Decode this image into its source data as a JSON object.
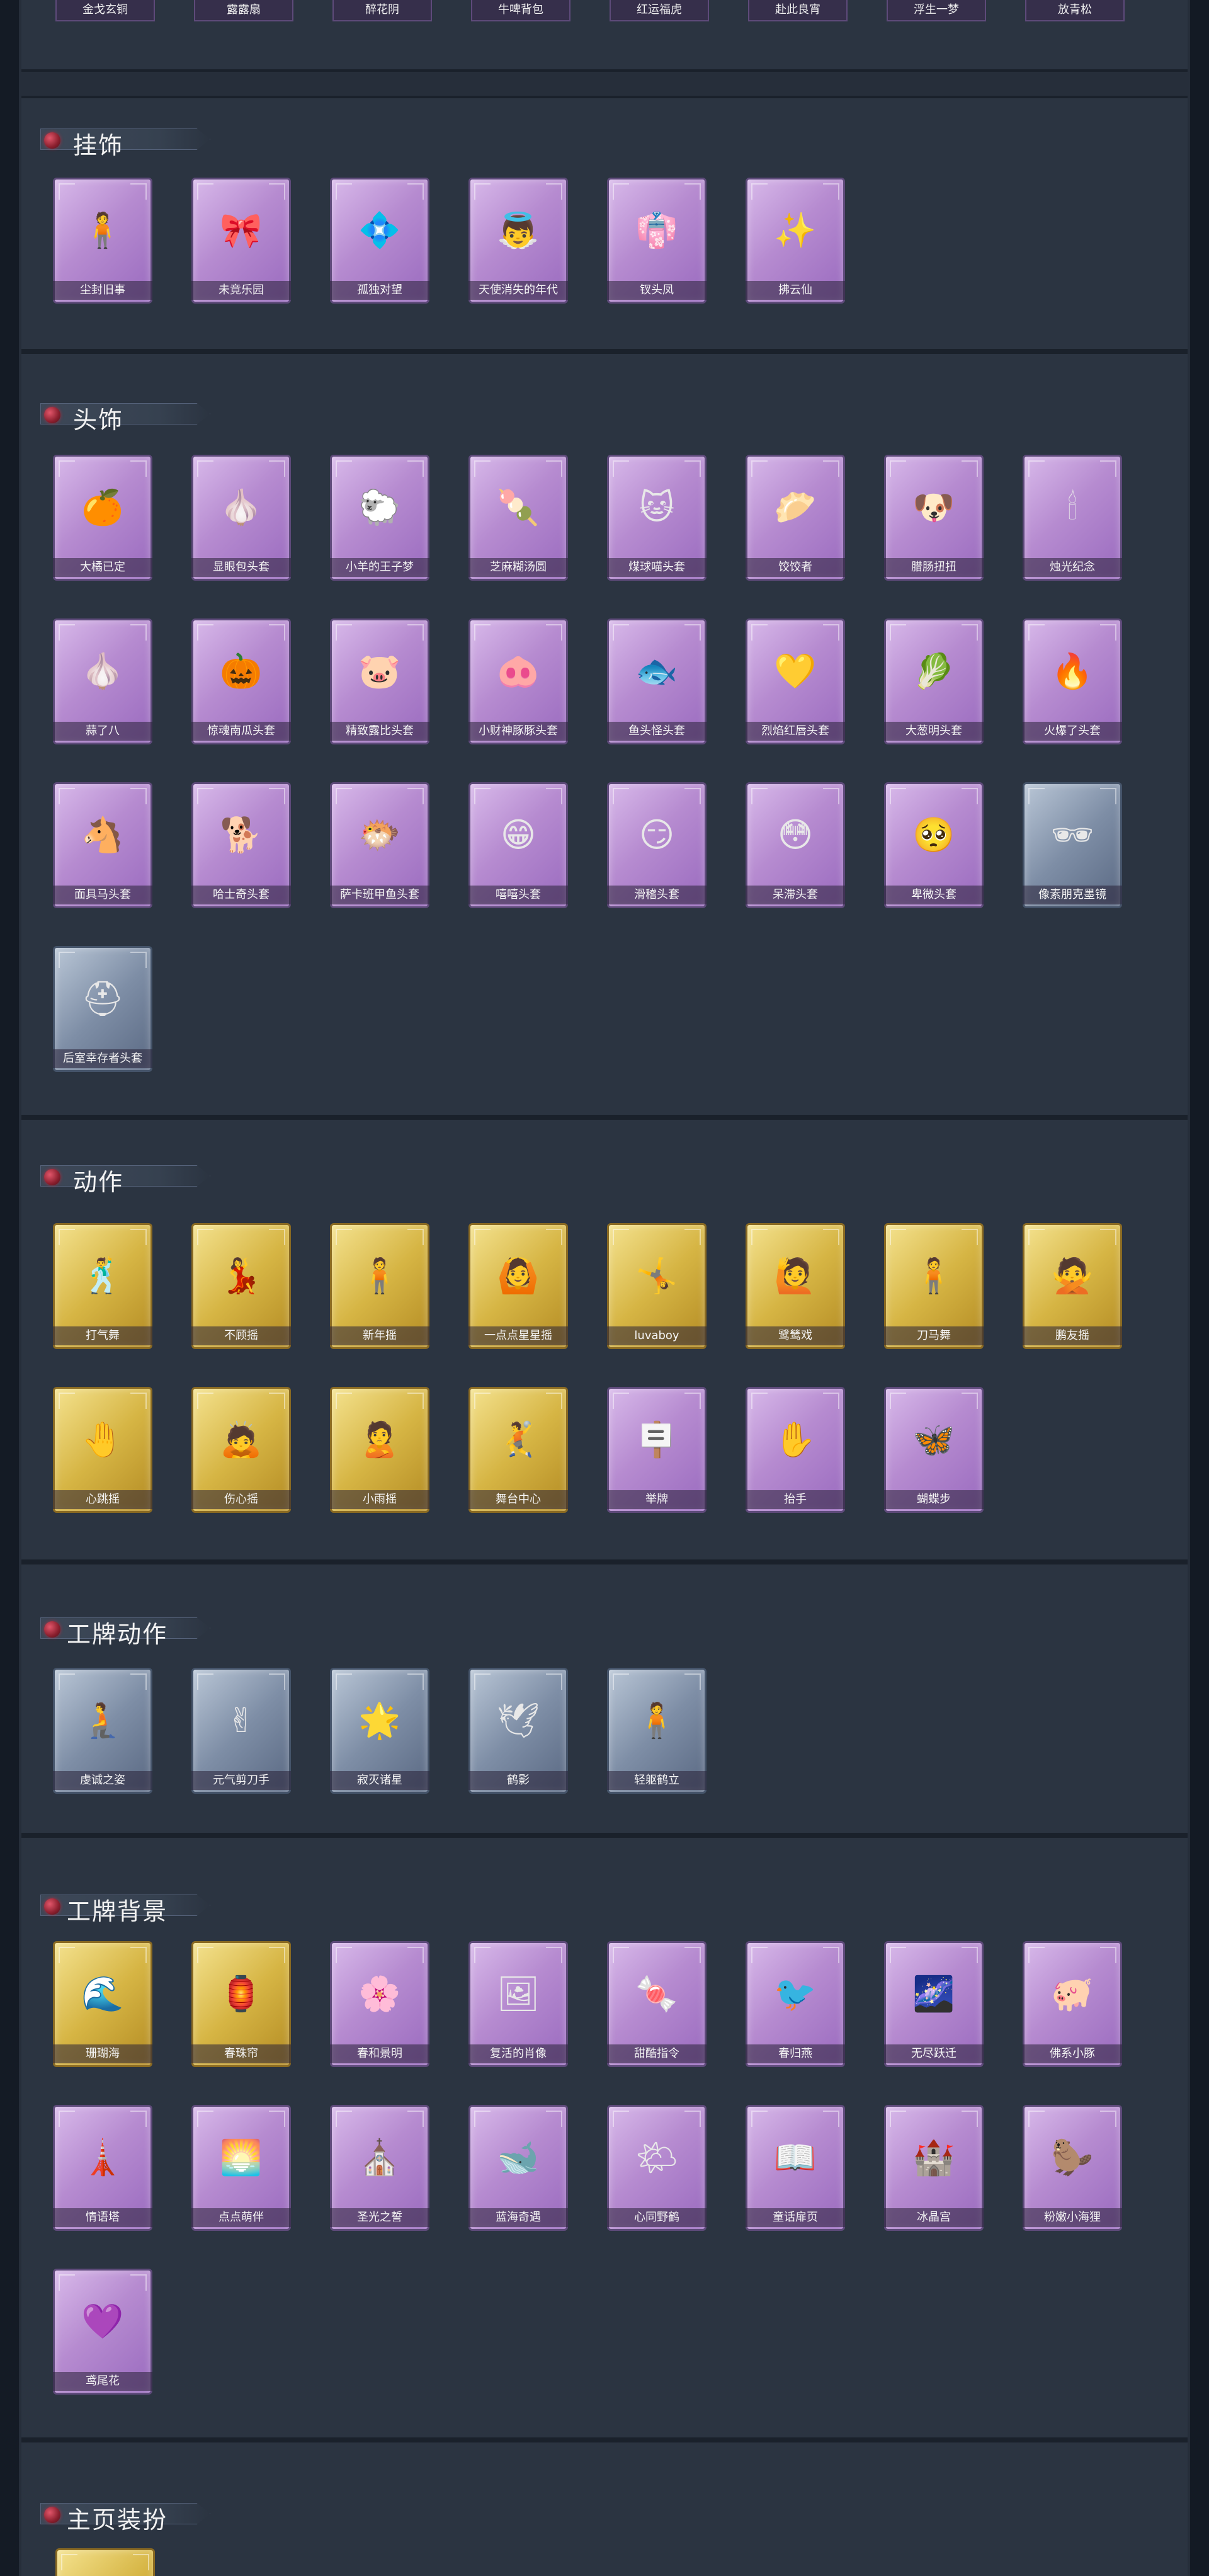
{
  "top_strip": [
    "金戈玄铜",
    "露露扇",
    "醉花阴",
    "牛啤背包",
    "红运福虎",
    "赴此良宵",
    "浮生一梦",
    "放青松"
  ],
  "sections": [
    {
      "id": "guashi",
      "title": "挂饰",
      "items": [
        {
          "label": "尘封旧事",
          "icon": "🧍",
          "style": "purple"
        },
        {
          "label": "未竟乐园",
          "icon": "🎀",
          "style": "purple"
        },
        {
          "label": "孤独对望",
          "icon": "💠",
          "style": "purple"
        },
        {
          "label": "天使消失的年代",
          "icon": "👼",
          "style": "purple"
        },
        {
          "label": "钗头凤",
          "icon": "👘",
          "style": "purple"
        },
        {
          "label": "拂云仙",
          "icon": "✨",
          "style": "purple"
        }
      ]
    },
    {
      "id": "toushi",
      "title": "头饰",
      "items": [
        {
          "label": "大橘已定",
          "icon": "🍊",
          "style": "purple"
        },
        {
          "label": "显眼包头套",
          "icon": "🧄",
          "style": "purple"
        },
        {
          "label": "小羊的王子梦",
          "icon": "🐑",
          "style": "purple"
        },
        {
          "label": "芝麻糊汤圆",
          "icon": "🍡",
          "style": "purple"
        },
        {
          "label": "煤球喵头套",
          "icon": "🐱",
          "style": "purple"
        },
        {
          "label": "饺饺者",
          "icon": "🥟",
          "style": "purple"
        },
        {
          "label": "腊肠扭扭",
          "icon": "🐶",
          "style": "purple"
        },
        {
          "label": "烛光纪念",
          "icon": "🕯",
          "style": "purple"
        },
        {
          "label": "蒜了八",
          "icon": "🧄",
          "style": "purple"
        },
        {
          "label": "惊魂南瓜头套",
          "icon": "🎃",
          "style": "purple"
        },
        {
          "label": "精致露比头套",
          "icon": "🐷",
          "style": "purple"
        },
        {
          "label": "小财神豚豚头套",
          "icon": "🐽",
          "style": "purple"
        },
        {
          "label": "鱼头怪头套",
          "icon": "🐟",
          "style": "purple"
        },
        {
          "label": "烈焰红唇头套",
          "icon": "💛",
          "style": "purple"
        },
        {
          "label": "大葱明头套",
          "icon": "🥬",
          "style": "purple"
        },
        {
          "label": "火爆了头套",
          "icon": "🔥",
          "style": "purple"
        },
        {
          "label": "面具马头套",
          "icon": "🐴",
          "style": "purple"
        },
        {
          "label": "哈士奇头套",
          "icon": "🐕",
          "style": "purple"
        },
        {
          "label": "萨卡班甲鱼头套",
          "icon": "🐡",
          "style": "purple"
        },
        {
          "label": "嘻嘻头套",
          "icon": "😁",
          "style": "purple"
        },
        {
          "label": "滑稽头套",
          "icon": "😏",
          "style": "purple"
        },
        {
          "label": "呆滞头套",
          "icon": "😳",
          "style": "purple"
        },
        {
          "label": "卑微头套",
          "icon": "🥺",
          "style": "purple"
        },
        {
          "label": "像素朋克墨镜",
          "icon": "🕶",
          "style": "blue"
        },
        {
          "label": "后室幸存者头套",
          "icon": "⛑",
          "style": "blue"
        }
      ]
    },
    {
      "id": "dongzuo",
      "title": "动作",
      "items": [
        {
          "label": "打气舞",
          "icon": "🕺",
          "style": "gold"
        },
        {
          "label": "不顾摇",
          "icon": "💃",
          "style": "gold"
        },
        {
          "label": "新年摇",
          "icon": "🧍",
          "style": "gold"
        },
        {
          "label": "一点点星星摇",
          "icon": "🙆",
          "style": "gold"
        },
        {
          "label": "luvaboy",
          "icon": "🤸",
          "style": "gold"
        },
        {
          "label": "鹭鸶戏",
          "icon": "🙋",
          "style": "gold"
        },
        {
          "label": "刀马舞",
          "icon": "🧍",
          "style": "gold"
        },
        {
          "label": "鹏友摇",
          "icon": "🙅",
          "style": "gold"
        },
        {
          "label": "心跳摇",
          "icon": "🤚",
          "style": "gold"
        },
        {
          "label": "伤心摇",
          "icon": "🙇",
          "style": "gold"
        },
        {
          "label": "小雨摇",
          "icon": "🙎",
          "style": "gold"
        },
        {
          "label": "舞台中心",
          "icon": "🤾",
          "style": "gold"
        },
        {
          "label": "举牌",
          "icon": "🪧",
          "style": "purple"
        },
        {
          "label": "抬手",
          "icon": "✋",
          "style": "purple"
        },
        {
          "label": "蝴蝶步",
          "icon": "🦋",
          "style": "purple"
        }
      ]
    },
    {
      "id": "gongpai_dongzuo",
      "title": "工牌动作",
      "items": [
        {
          "label": "虔诚之姿",
          "icon": "🧎",
          "style": "blue"
        },
        {
          "label": "元气剪刀手",
          "icon": "✌",
          "style": "blue"
        },
        {
          "label": "寂灭诸星",
          "icon": "🌟",
          "style": "blue"
        },
        {
          "label": "鹤影",
          "icon": "🕊",
          "style": "blue"
        },
        {
          "label": "轻躯鹤立",
          "icon": "🧍",
          "style": "blue"
        }
      ]
    },
    {
      "id": "gongpai_beijing",
      "title": "工牌背景",
      "items": [
        {
          "label": "珊瑚海",
          "icon": "🌊",
          "style": "gold"
        },
        {
          "label": "春珠帘",
          "icon": "🏮",
          "style": "gold"
        },
        {
          "label": "春和景明",
          "icon": "🌸",
          "style": "purple"
        },
        {
          "label": "复活的肖像",
          "icon": "🖼",
          "style": "purple"
        },
        {
          "label": "甜酷指令",
          "icon": "🍬",
          "style": "purple"
        },
        {
          "label": "春归燕",
          "icon": "🐦",
          "style": "purple"
        },
        {
          "label": "无尽跃迁",
          "icon": "🌌",
          "style": "purple"
        },
        {
          "label": "佛系小豚",
          "icon": "🐖",
          "style": "purple"
        },
        {
          "label": "情语塔",
          "icon": "🗼",
          "style": "purple"
        },
        {
          "label": "点点萌伴",
          "icon": "🌅",
          "style": "purple"
        },
        {
          "label": "圣光之誓",
          "icon": "⛪",
          "style": "purple"
        },
        {
          "label": "蓝海奇遇",
          "icon": "🐋",
          "style": "purple"
        },
        {
          "label": "心同野鹤",
          "icon": "🌤",
          "style": "purple"
        },
        {
          "label": "童话扉页",
          "icon": "📖",
          "style": "purple"
        },
        {
          "label": "冰晶宫",
          "icon": "🏰",
          "style": "purple"
        },
        {
          "label": "粉嫩小海狸",
          "icon": "🦫",
          "style": "purple"
        },
        {
          "label": "鸢尾花",
          "icon": "💜",
          "style": "purple"
        }
      ]
    },
    {
      "id": "zhuye",
      "title": "主页装扮",
      "items": []
    }
  ]
}
